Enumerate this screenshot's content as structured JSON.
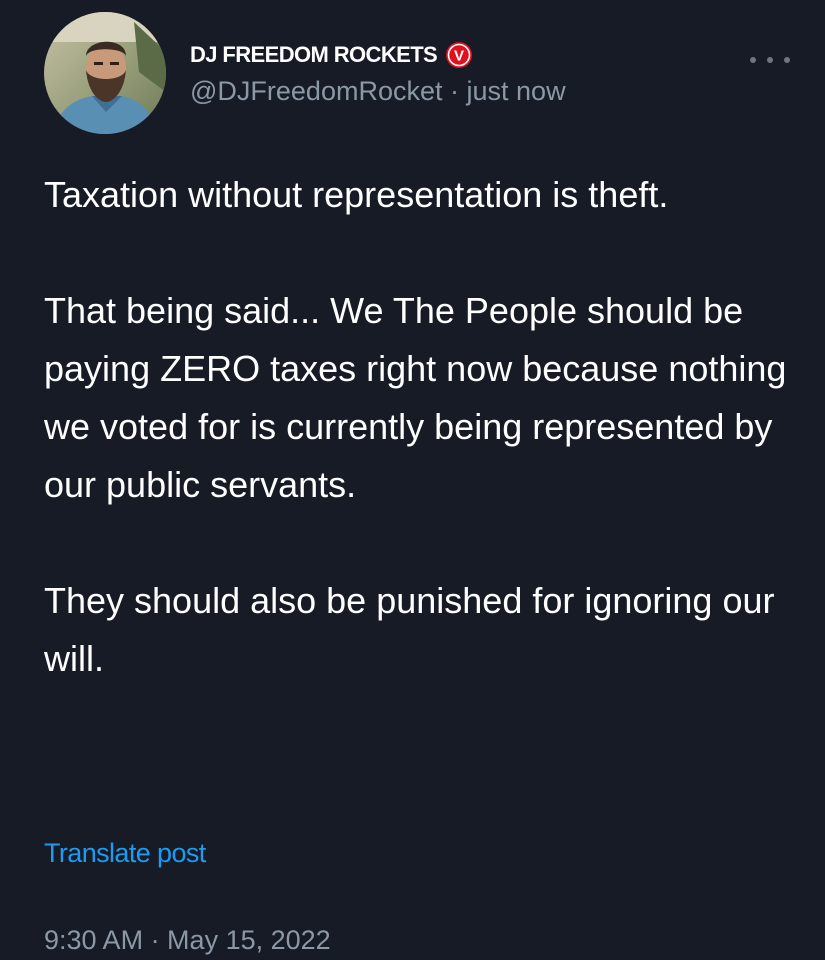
{
  "author": {
    "display_name": "DJ FREEDOM ROCKETS",
    "badge_letter": "V",
    "handle": "@DJFreedomRocket",
    "separator": "·",
    "relative_time": "just now"
  },
  "post": {
    "paragraphs": [
      "Taxation without representation is theft.",
      "That being said... We The People should be paying ZERO taxes right now because nothing we voted for is currently being represented by our public servants.",
      "They should also be punished for ignoring our will."
    ]
  },
  "translate_label": "Translate post",
  "timestamp": "9:30 AM · May 15, 2022",
  "icons": {
    "more": "more-horizontal-icon",
    "badge": "verified-badge-icon"
  },
  "colors": {
    "background": "#161b26",
    "text": "#ffffff",
    "secondary_text": "#8b98a5",
    "link": "#1d9bf0",
    "badge": "#e0111f"
  }
}
